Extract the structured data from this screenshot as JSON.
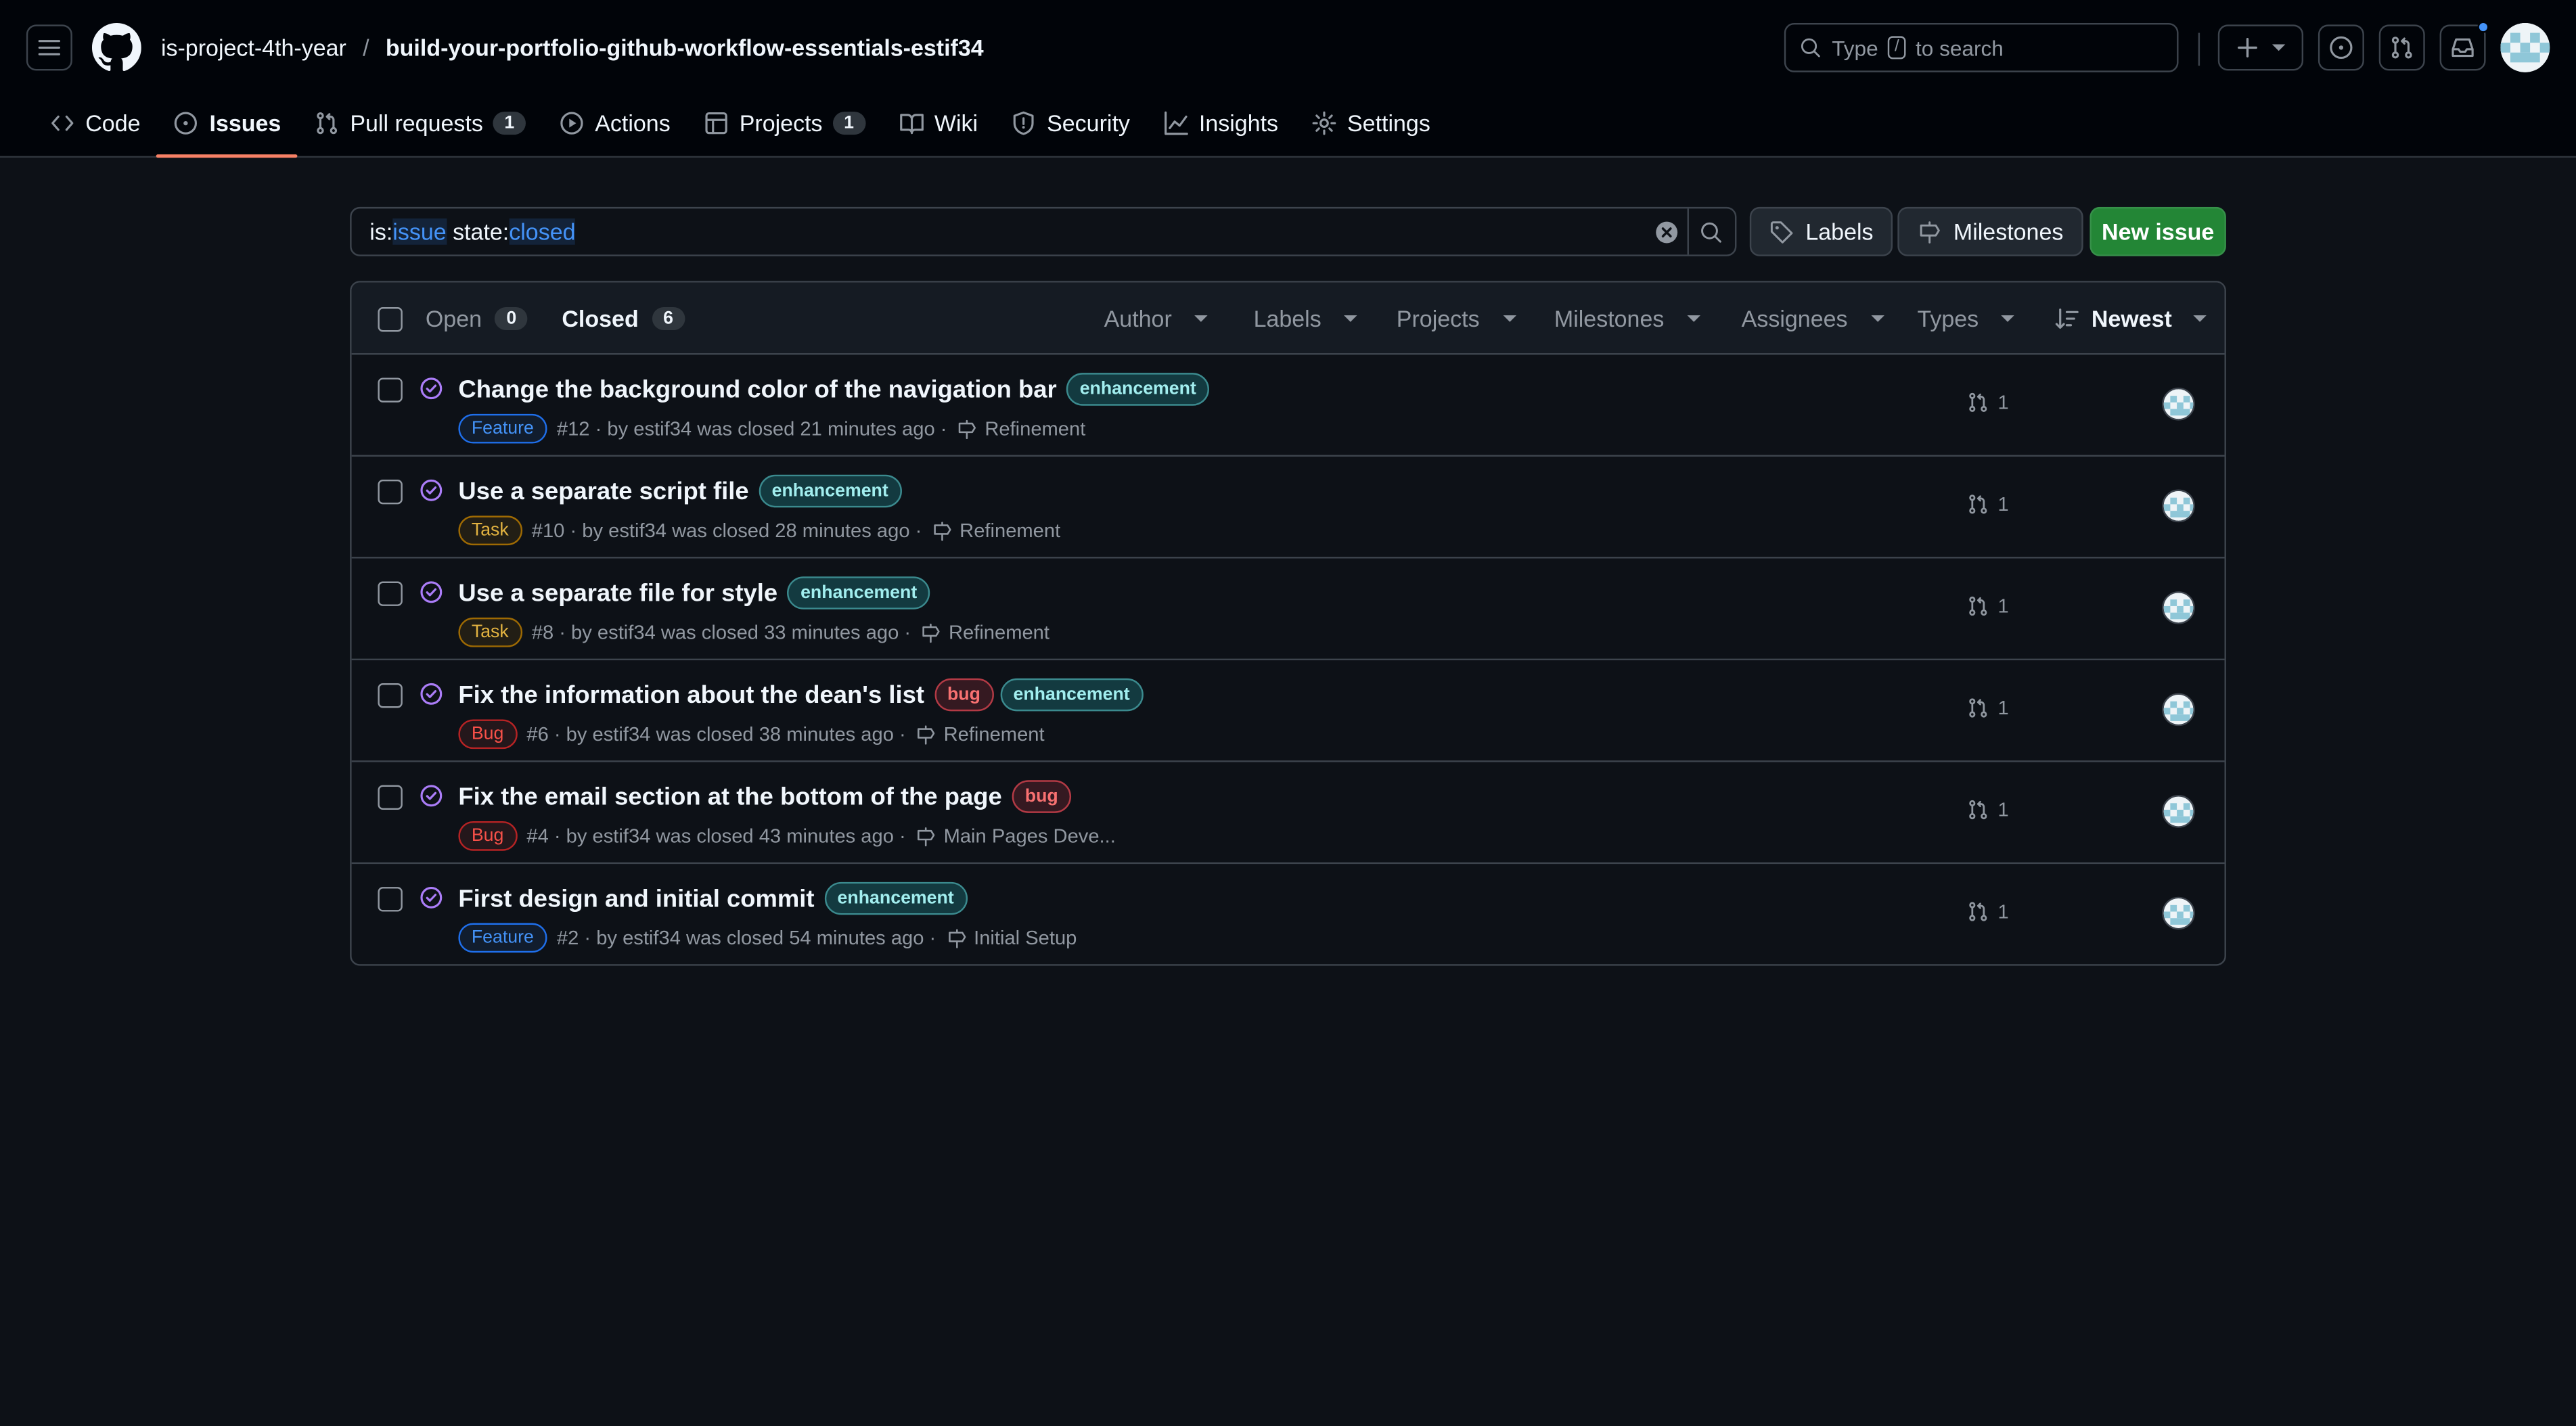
{
  "header": {
    "owner": "is-project-4th-year",
    "separator": "/",
    "repo": "build-your-portfolio-github-workflow-essentials-estif34",
    "search_prefix": "Type",
    "search_key": "/",
    "search_suffix": "to search"
  },
  "repo_nav": [
    {
      "label": "Code",
      "icon": "code-icon"
    },
    {
      "label": "Issues",
      "icon": "issue-opened-icon",
      "active": true
    },
    {
      "label": "Pull requests",
      "icon": "git-pull-request-icon",
      "count": "1"
    },
    {
      "label": "Actions",
      "icon": "play-icon"
    },
    {
      "label": "Projects",
      "icon": "table-icon",
      "count": "1"
    },
    {
      "label": "Wiki",
      "icon": "book-icon"
    },
    {
      "label": "Security",
      "icon": "shield-icon"
    },
    {
      "label": "Insights",
      "icon": "graph-icon"
    },
    {
      "label": "Settings",
      "icon": "gear-icon"
    }
  ],
  "filter": {
    "k1": "is:",
    "v1": "issue",
    "k2": " state:",
    "v2": "closed"
  },
  "buttons": {
    "labels": "Labels",
    "milestones": "Milestones",
    "new_issue": "New issue"
  },
  "list_header": {
    "open_label": "Open",
    "open_count": "0",
    "closed_label": "Closed",
    "closed_count": "6",
    "filters": [
      "Author",
      "Labels",
      "Projects",
      "Milestones",
      "Assignees",
      "Types"
    ],
    "sort": "Newest"
  },
  "issues": [
    {
      "title": "Change the background color of the navigation bar",
      "labels": [
        "enhancement"
      ],
      "type": "Feature",
      "meta": "#12 · by estif34 was closed 21 minutes ago ·",
      "milestone": "Refinement",
      "prs": "1"
    },
    {
      "title": "Use a separate script file",
      "labels": [
        "enhancement"
      ],
      "type": "Task",
      "meta": "#10 · by estif34 was closed 28 minutes ago ·",
      "milestone": "Refinement",
      "prs": "1"
    },
    {
      "title": "Use a separate file for style",
      "labels": [
        "enhancement"
      ],
      "type": "Task",
      "meta": "#8 · by estif34 was closed 33 minutes ago ·",
      "milestone": "Refinement",
      "prs": "1"
    },
    {
      "title": "Fix the information about the dean's list",
      "labels": [
        "bug",
        "enhancement"
      ],
      "type": "Bug",
      "meta": "#6 · by estif34 was closed 38 minutes ago ·",
      "milestone": "Refinement",
      "prs": "1"
    },
    {
      "title": "Fix the email section at the bottom of the page",
      "labels": [
        "bug"
      ],
      "type": "Bug",
      "meta": "#4 · by estif34 was closed 43 minutes ago ·",
      "milestone": "Main Pages Deve...",
      "prs": "1"
    },
    {
      "title": "First design and initial commit",
      "labels": [
        "enhancement"
      ],
      "type": "Feature",
      "meta": "#2 · by estif34 was closed 54 minutes ago ·",
      "milestone": "Initial Setup",
      "prs": "1"
    }
  ],
  "colors": {
    "background": "#0d1117",
    "header_bg": "#010409",
    "accent_underline": "#f78166",
    "closed_purple": "#ab7df8",
    "primary_green": "#238636",
    "link_blue": "#4493f8"
  }
}
